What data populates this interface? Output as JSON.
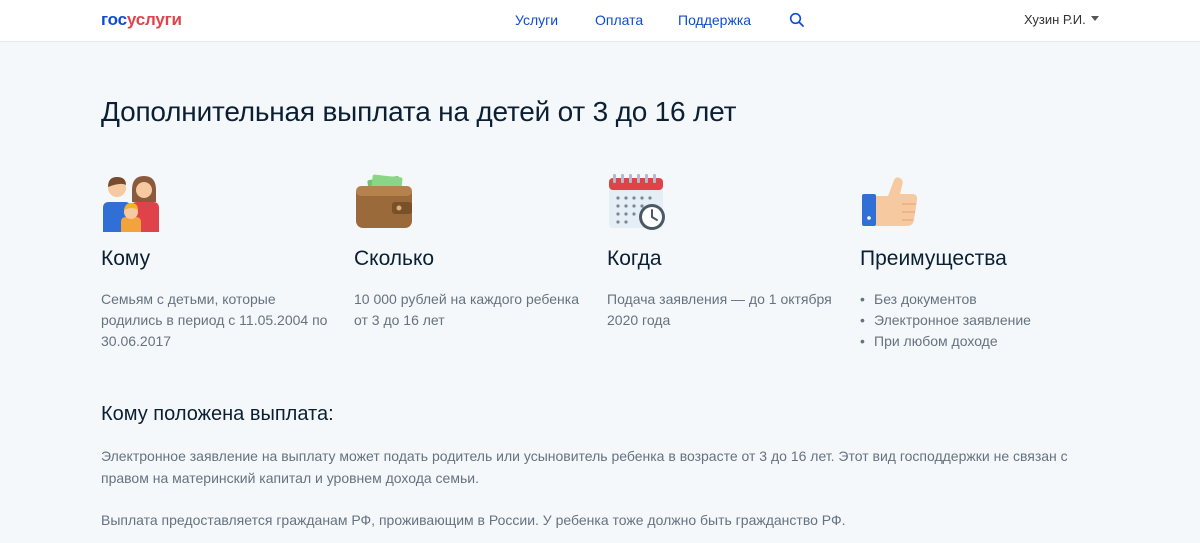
{
  "header": {
    "logo_part1": "гос",
    "logo_part2": "услуги",
    "nav": [
      "Услуги",
      "Оплата",
      "Поддержка"
    ],
    "user_name": "Хузин Р.И."
  },
  "page": {
    "title": "Дополнительная выплата на детей от 3 до 16 лет"
  },
  "features": [
    {
      "title": "Кому",
      "text": "Семьям с детьми, которые родились в период с 11.05.2004 по 30.06.2017",
      "icon": "family-icon"
    },
    {
      "title": "Сколько",
      "text": "10 000 рублей на каждого ребенка от 3 до 16 лет",
      "icon": "wallet-icon"
    },
    {
      "title": "Когда",
      "text": "Подача заявления — до 1 октября 2020 года",
      "icon": "calendar-clock-icon"
    },
    {
      "title": "Преимущества",
      "items": [
        "Без документов",
        "Электронное заявление",
        "При любом доходе"
      ],
      "icon": "thumbs-up-icon"
    }
  ],
  "eligibility": {
    "heading": "Кому положена выплата:",
    "p1": "Электронное заявление на выплату может подать родитель или усыновитель ребенка в возрасте от 3 до 16 лет. Этот вид господдержки не связан с правом на материнский капитал и уровнем дохода семьи.",
    "p2": "Выплата предоставляется гражданам РФ, проживающим в России. У ребенка тоже должно быть гражданство РФ."
  },
  "colors": {
    "brand_blue": "#0d4cd3",
    "brand_red": "#e2434b",
    "text": "#0b1f33",
    "muted": "#66727f",
    "bg": "#f5f8fb"
  }
}
